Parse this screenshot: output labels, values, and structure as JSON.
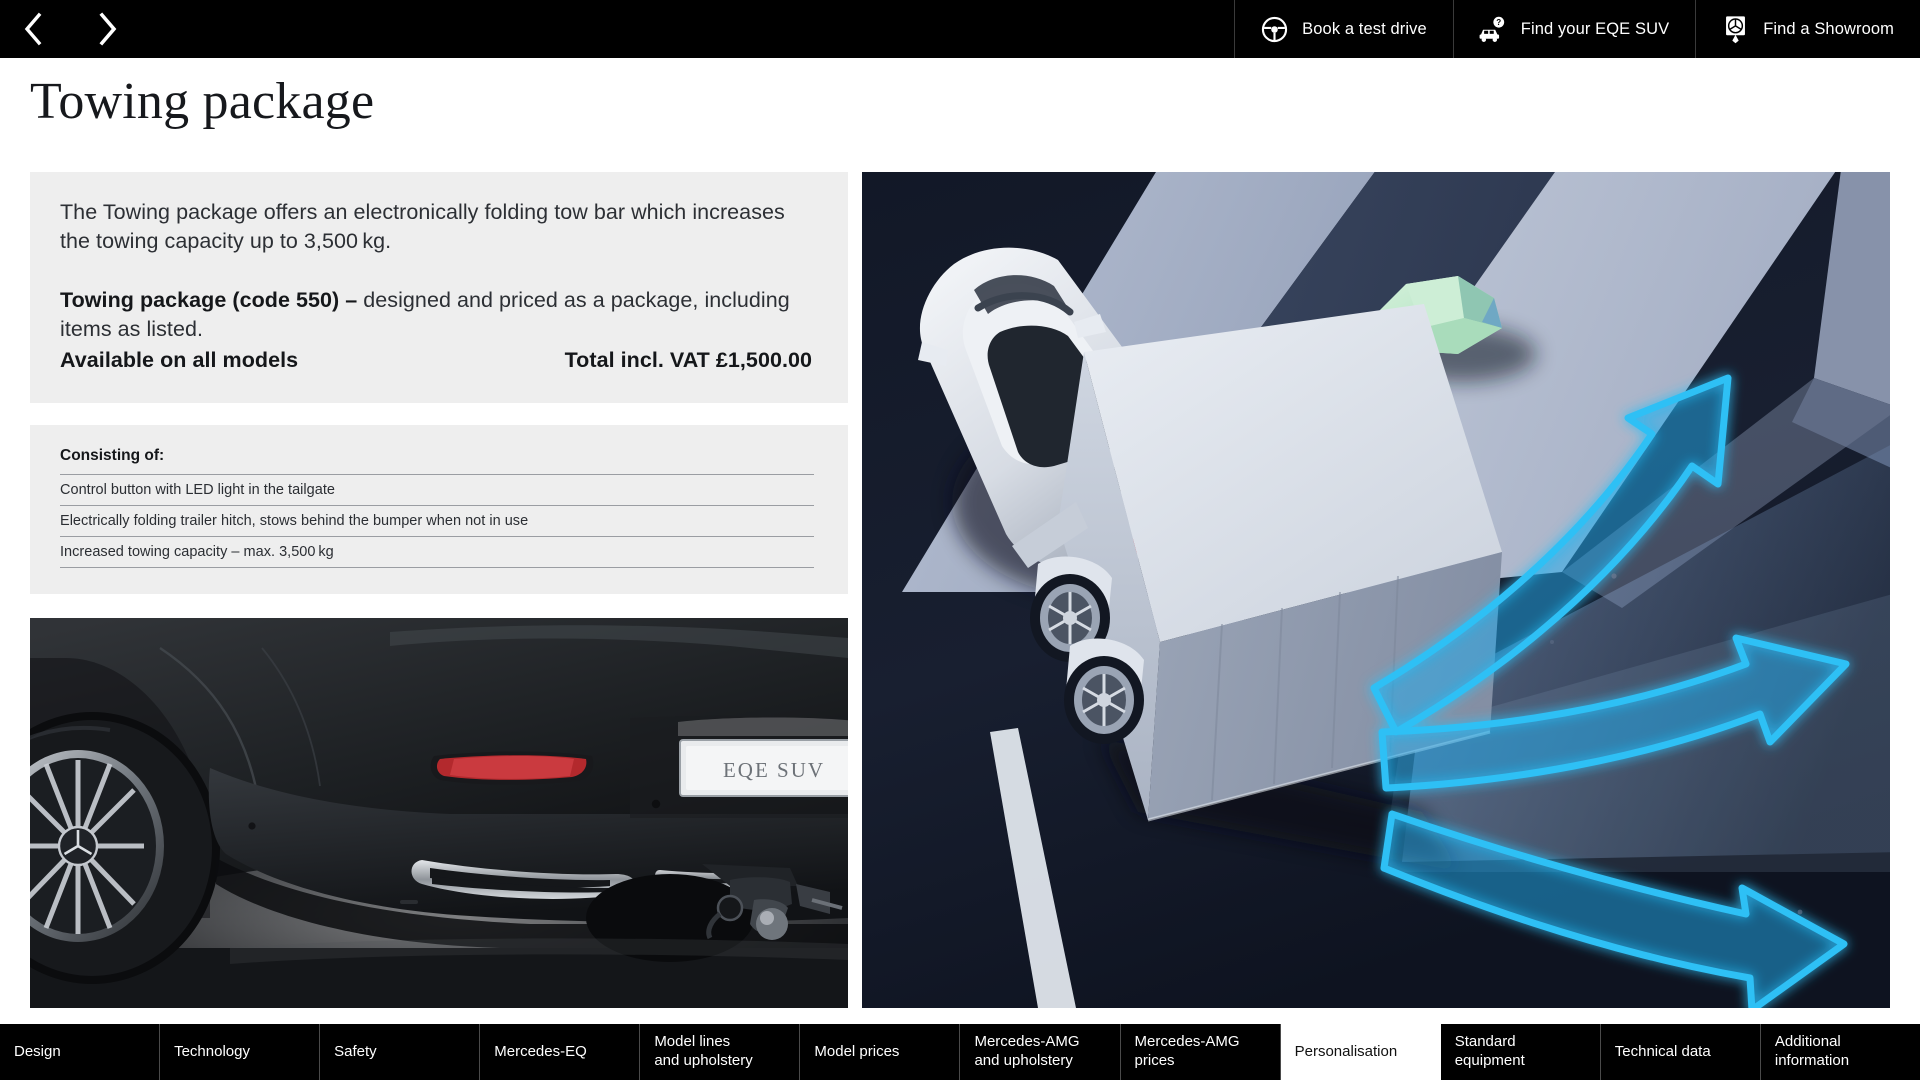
{
  "topbar": {
    "prev_icon": "chevron-left-icon",
    "next_icon": "chevron-right-icon",
    "actions": [
      {
        "label": "Book a test drive",
        "icon": "steering-wheel-icon"
      },
      {
        "label": "Find your EQE SUV",
        "icon": "car-question-icon"
      },
      {
        "label": "Find a Showroom",
        "icon": "location-pin-mercedes-icon"
      }
    ]
  },
  "page": {
    "title": "Towing package"
  },
  "description": {
    "intro": "The Towing package offers an electronically folding tow bar which increases the towing capacity up to 3,500 kg.",
    "package_bold": "Towing package (code 550) –",
    "package_rest": " designed and priced as a package, including items as listed.",
    "availability": "Available on all models",
    "price": "Total incl. VAT £1,500.00"
  },
  "consisting": {
    "heading": "Consisting of:",
    "items": [
      "Control button with LED light in the tailgate",
      "Electrically folding trailer hitch, stows behind the bumper when not in use",
      "Increased towing capacity – max. 3,500 kg"
    ]
  },
  "images": {
    "car_photo": {
      "name": "eqe-suv-rear-towbar-photo",
      "plate_text": "EQE SUV"
    },
    "render": {
      "name": "car-trailer-reversing-render",
      "arrow_color": "#27a8e8",
      "gem_color": "#bfe6c8",
      "road_color": "#161c2c"
    }
  },
  "tabs": [
    {
      "label": "Design",
      "lines": [
        "Design"
      ],
      "active": false
    },
    {
      "label": "Technology",
      "lines": [
        "Technology"
      ],
      "active": false
    },
    {
      "label": "Safety",
      "lines": [
        "Safety"
      ],
      "active": false
    },
    {
      "label": "Mercedes-EQ",
      "lines": [
        "Mercedes-EQ"
      ],
      "active": false
    },
    {
      "label": "Model lines and upholstery",
      "lines": [
        "Model lines",
        "and upholstery"
      ],
      "active": false
    },
    {
      "label": "Model prices",
      "lines": [
        "Model prices"
      ],
      "active": false
    },
    {
      "label": "Mercedes-AMG and upholstery",
      "lines": [
        "Mercedes-AMG",
        "and upholstery"
      ],
      "active": false
    },
    {
      "label": "Mercedes-AMG prices",
      "lines": [
        "Mercedes-AMG",
        "prices"
      ],
      "active": false
    },
    {
      "label": "Personalisation",
      "lines": [
        "Personalisation"
      ],
      "active": true
    },
    {
      "label": "Standard equipment",
      "lines": [
        "Standard",
        "equipment"
      ],
      "active": false
    },
    {
      "label": "Technical data",
      "lines": [
        "Technical data"
      ],
      "active": false
    },
    {
      "label": "Additional information",
      "lines": [
        "Additional",
        "information"
      ],
      "active": false
    }
  ]
}
